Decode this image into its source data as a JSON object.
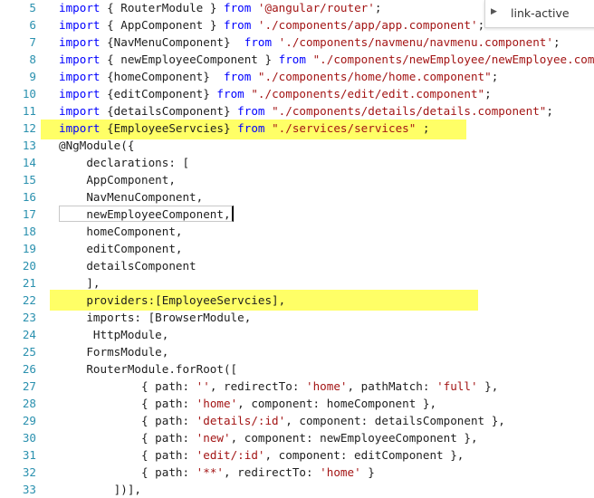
{
  "find_widget": {
    "value": "link-active",
    "toggle_icon": "chevron-right-icon"
  },
  "lines": [
    {
      "num": "5",
      "tokens": [
        {
          "t": "import",
          "c": "kw"
        },
        {
          "t": " { RouterModule } "
        },
        {
          "t": "from",
          "c": "kw"
        },
        {
          "t": " "
        },
        {
          "t": "'@angular/router'",
          "c": "str"
        },
        {
          "t": ";"
        }
      ]
    },
    {
      "num": "6",
      "tokens": [
        {
          "t": "import",
          "c": "kw"
        },
        {
          "t": " { AppComponent } "
        },
        {
          "t": "from",
          "c": "kw"
        },
        {
          "t": " "
        },
        {
          "t": "'./components/app/app.component'",
          "c": "str"
        },
        {
          "t": ";"
        }
      ]
    },
    {
      "num": "7",
      "tokens": [
        {
          "t": "import",
          "c": "kw"
        },
        {
          "t": " {NavMenuComponent}  "
        },
        {
          "t": "from",
          "c": "kw"
        },
        {
          "t": " "
        },
        {
          "t": "'./components/navmenu/navmenu.component'",
          "c": "str"
        },
        {
          "t": ";"
        }
      ]
    },
    {
      "num": "8",
      "tokens": [
        {
          "t": "import",
          "c": "kw"
        },
        {
          "t": " { newEmployeeComponent } "
        },
        {
          "t": "from",
          "c": "kw"
        },
        {
          "t": " "
        },
        {
          "t": "\"./components/newEmployee/newEmployee.com",
          "c": "str"
        }
      ]
    },
    {
      "num": "9",
      "tokens": [
        {
          "t": "import",
          "c": "kw"
        },
        {
          "t": " {homeComponent}  "
        },
        {
          "t": "from",
          "c": "kw"
        },
        {
          "t": " "
        },
        {
          "t": "\"./components/home/home.component\"",
          "c": "str"
        },
        {
          "t": ";"
        }
      ]
    },
    {
      "num": "10",
      "tokens": [
        {
          "t": "import",
          "c": "kw"
        },
        {
          "t": " {editComponent} "
        },
        {
          "t": "from",
          "c": "kw"
        },
        {
          "t": " "
        },
        {
          "t": "\"./components/edit/edit.component\"",
          "c": "str"
        },
        {
          "t": ";"
        }
      ]
    },
    {
      "num": "11",
      "tokens": [
        {
          "t": "import",
          "c": "kw"
        },
        {
          "t": " {detailsComponent} "
        },
        {
          "t": "from",
          "c": "kw"
        },
        {
          "t": " "
        },
        {
          "t": "\"./components/details/details.component\"",
          "c": "str"
        },
        {
          "t": ";"
        }
      ]
    },
    {
      "num": "12",
      "tokens": [
        {
          "t": "import",
          "c": "kw"
        },
        {
          "t": " {EmployeeServcies} "
        },
        {
          "t": "from",
          "c": "kw"
        },
        {
          "t": " "
        },
        {
          "t": "\"./services/services\"",
          "c": "str"
        },
        {
          "t": " ;"
        }
      ]
    },
    {
      "num": "13",
      "tokens": [
        {
          "t": "@NgModule({"
        }
      ]
    },
    {
      "num": "14",
      "tokens": [
        {
          "t": "    declarations: ["
        }
      ]
    },
    {
      "num": "15",
      "tokens": [
        {
          "t": "    AppComponent,"
        }
      ]
    },
    {
      "num": "16",
      "tokens": [
        {
          "t": "    NavMenuComponent,"
        }
      ]
    },
    {
      "num": "17",
      "tokens": [
        {
          "t": "    newEmployeeComponent,"
        }
      ]
    },
    {
      "num": "18",
      "tokens": [
        {
          "t": "    homeComponent,"
        }
      ]
    },
    {
      "num": "19",
      "tokens": [
        {
          "t": "    editComponent,"
        }
      ]
    },
    {
      "num": "20",
      "tokens": [
        {
          "t": "    detailsComponent"
        }
      ]
    },
    {
      "num": "21",
      "tokens": [
        {
          "t": "    ],"
        }
      ]
    },
    {
      "num": "22",
      "tokens": [
        {
          "t": "    providers:[EmployeeServcies],"
        }
      ]
    },
    {
      "num": "23",
      "tokens": [
        {
          "t": "    imports: [BrowserModule,"
        }
      ]
    },
    {
      "num": "24",
      "tokens": [
        {
          "t": "     HttpModule,"
        }
      ]
    },
    {
      "num": "25",
      "tokens": [
        {
          "t": "    FormsModule,"
        }
      ]
    },
    {
      "num": "26",
      "tokens": [
        {
          "t": "    RouterModule.forRoot(["
        }
      ]
    },
    {
      "num": "27",
      "tokens": [
        {
          "t": "            { path: "
        },
        {
          "t": "''",
          "c": "str"
        },
        {
          "t": ", redirectTo: "
        },
        {
          "t": "'home'",
          "c": "str"
        },
        {
          "t": ", pathMatch: "
        },
        {
          "t": "'full'",
          "c": "str"
        },
        {
          "t": " },"
        }
      ]
    },
    {
      "num": "28",
      "tokens": [
        {
          "t": "            { path: "
        },
        {
          "t": "'home'",
          "c": "str"
        },
        {
          "t": ", component: homeComponent },"
        }
      ]
    },
    {
      "num": "29",
      "tokens": [
        {
          "t": "            { path: "
        },
        {
          "t": "'details/:id'",
          "c": "str"
        },
        {
          "t": ", component: detailsComponent },"
        }
      ]
    },
    {
      "num": "30",
      "tokens": [
        {
          "t": "            { path: "
        },
        {
          "t": "'new'",
          "c": "str"
        },
        {
          "t": ", component: newEmployeeComponent },"
        }
      ]
    },
    {
      "num": "31",
      "tokens": [
        {
          "t": "            { path: "
        },
        {
          "t": "'edit/:id'",
          "c": "str"
        },
        {
          "t": ", component: editComponent },"
        }
      ]
    },
    {
      "num": "32",
      "tokens": [
        {
          "t": "            { path: "
        },
        {
          "t": "'**'",
          "c": "str"
        },
        {
          "t": ", redirectTo: "
        },
        {
          "t": "'home'",
          "c": "str"
        },
        {
          "t": " }"
        }
      ]
    },
    {
      "num": "33",
      "tokens": [
        {
          "t": "        ])],"
        }
      ]
    }
  ]
}
